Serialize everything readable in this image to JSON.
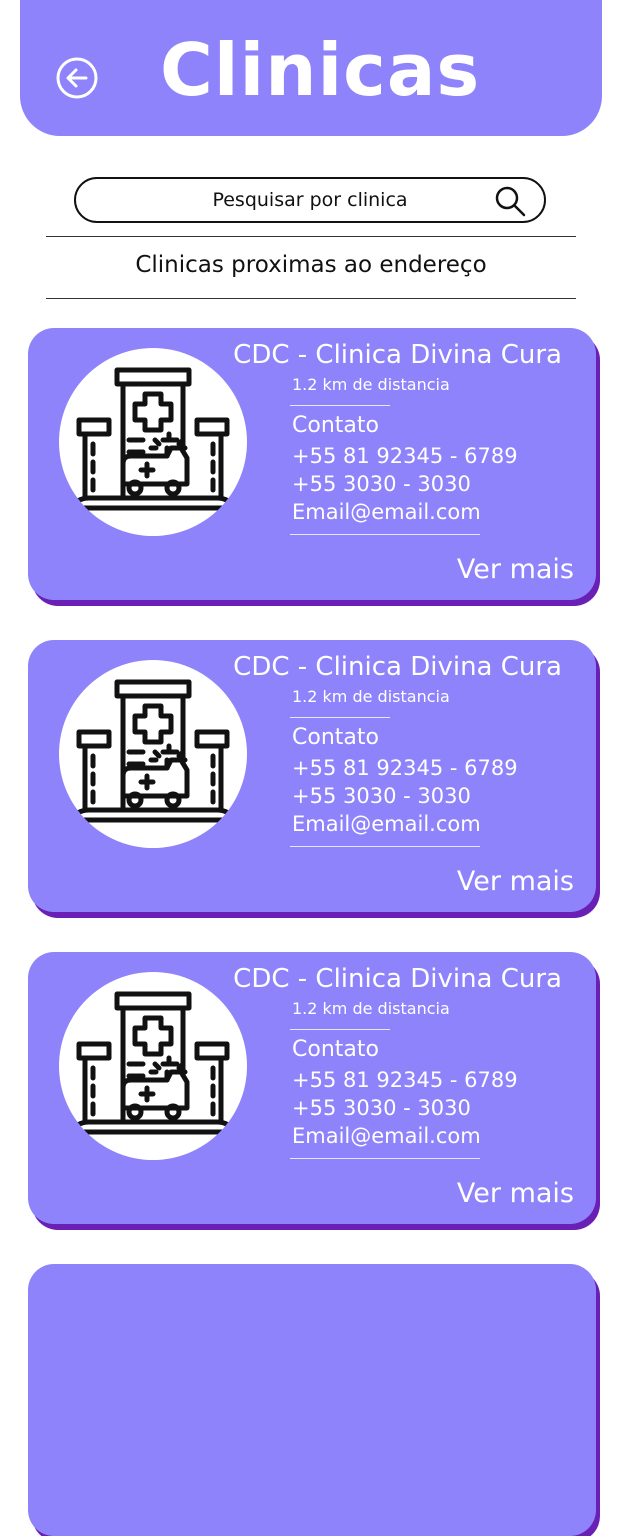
{
  "header": {
    "title": "Clinicas"
  },
  "search": {
    "placeholder": "Pesquisar por clinica"
  },
  "section": {
    "title": "Clinicas proximas ao endereço"
  },
  "clinics": [
    {
      "name": "CDC - Clinica Divina Cura",
      "distance": "1.2 km de distancia",
      "contact_label": "Contato",
      "phone1": "+55 81 92345 - 6789",
      "phone2": "+55 3030 - 3030",
      "email": "Email@email.com",
      "more": "Ver mais"
    },
    {
      "name": "CDC - Clinica Divina Cura",
      "distance": "1.2 km de distancia",
      "contact_label": "Contato",
      "phone1": "+55 81 92345 - 6789",
      "phone2": "+55 3030 - 3030",
      "email": "Email@email.com",
      "more": "Ver mais"
    },
    {
      "name": "CDC - Clinica Divina Cura",
      "distance": "1.2 km de distancia",
      "contact_label": "Contato",
      "phone1": "+55 81 92345 - 6789",
      "phone2": "+55 3030 - 3030",
      "email": "Email@email.com",
      "more": "Ver mais"
    }
  ],
  "colors": {
    "accent": "#8e83fb",
    "shadow": "#6a1fb5"
  }
}
